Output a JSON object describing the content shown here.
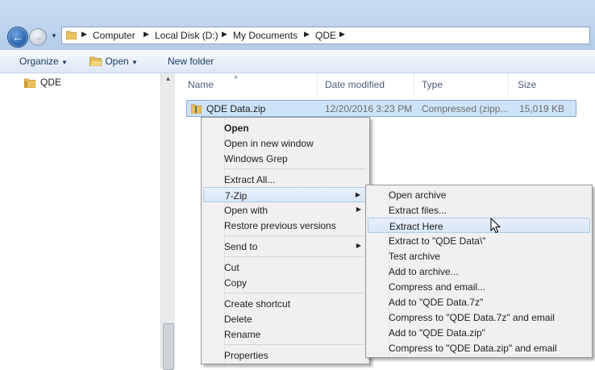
{
  "address_bar": {
    "crumbs": [
      "Computer",
      "Local Disk (D:)",
      "My Documents",
      "QDE"
    ]
  },
  "toolbar": {
    "organize": "Organize",
    "open": "Open",
    "new_folder": "New folder"
  },
  "nav_pane": {
    "items": [
      "QDE"
    ]
  },
  "columns": {
    "name": "Name",
    "date_modified": "Date modified",
    "type": "Type",
    "size": "Size"
  },
  "file": {
    "name": "QDE Data.zip",
    "date": "12/20/2016 3:23 PM",
    "type": "Compressed (zipp...",
    "size": "15,019 KB"
  },
  "context_menu": {
    "items": [
      "Open",
      "Open in new window",
      "Windows Grep",
      "Extract All...",
      "7-Zip",
      "Open with",
      "Restore previous versions",
      "Send to",
      "Cut",
      "Copy",
      "Create shortcut",
      "Delete",
      "Rename",
      "Properties"
    ]
  },
  "submenu_7zip": {
    "items": [
      "Open archive",
      "Extract files...",
      "Extract Here",
      "Extract to \"QDE Data\\\"",
      "Test archive",
      "Add to archive...",
      "Compress and email...",
      "Add to \"QDE Data.7z\"",
      "Compress to \"QDE Data.7z\" and email",
      "Add to \"QDE Data.zip\"",
      "Compress to \"QDE Data.zip\" and email"
    ],
    "highlighted": "Extract Here"
  },
  "colors": {
    "selection": "#cde3f8",
    "menu_bg": "#f0f0f0",
    "address_bar_bg": "#c9dcf2"
  }
}
